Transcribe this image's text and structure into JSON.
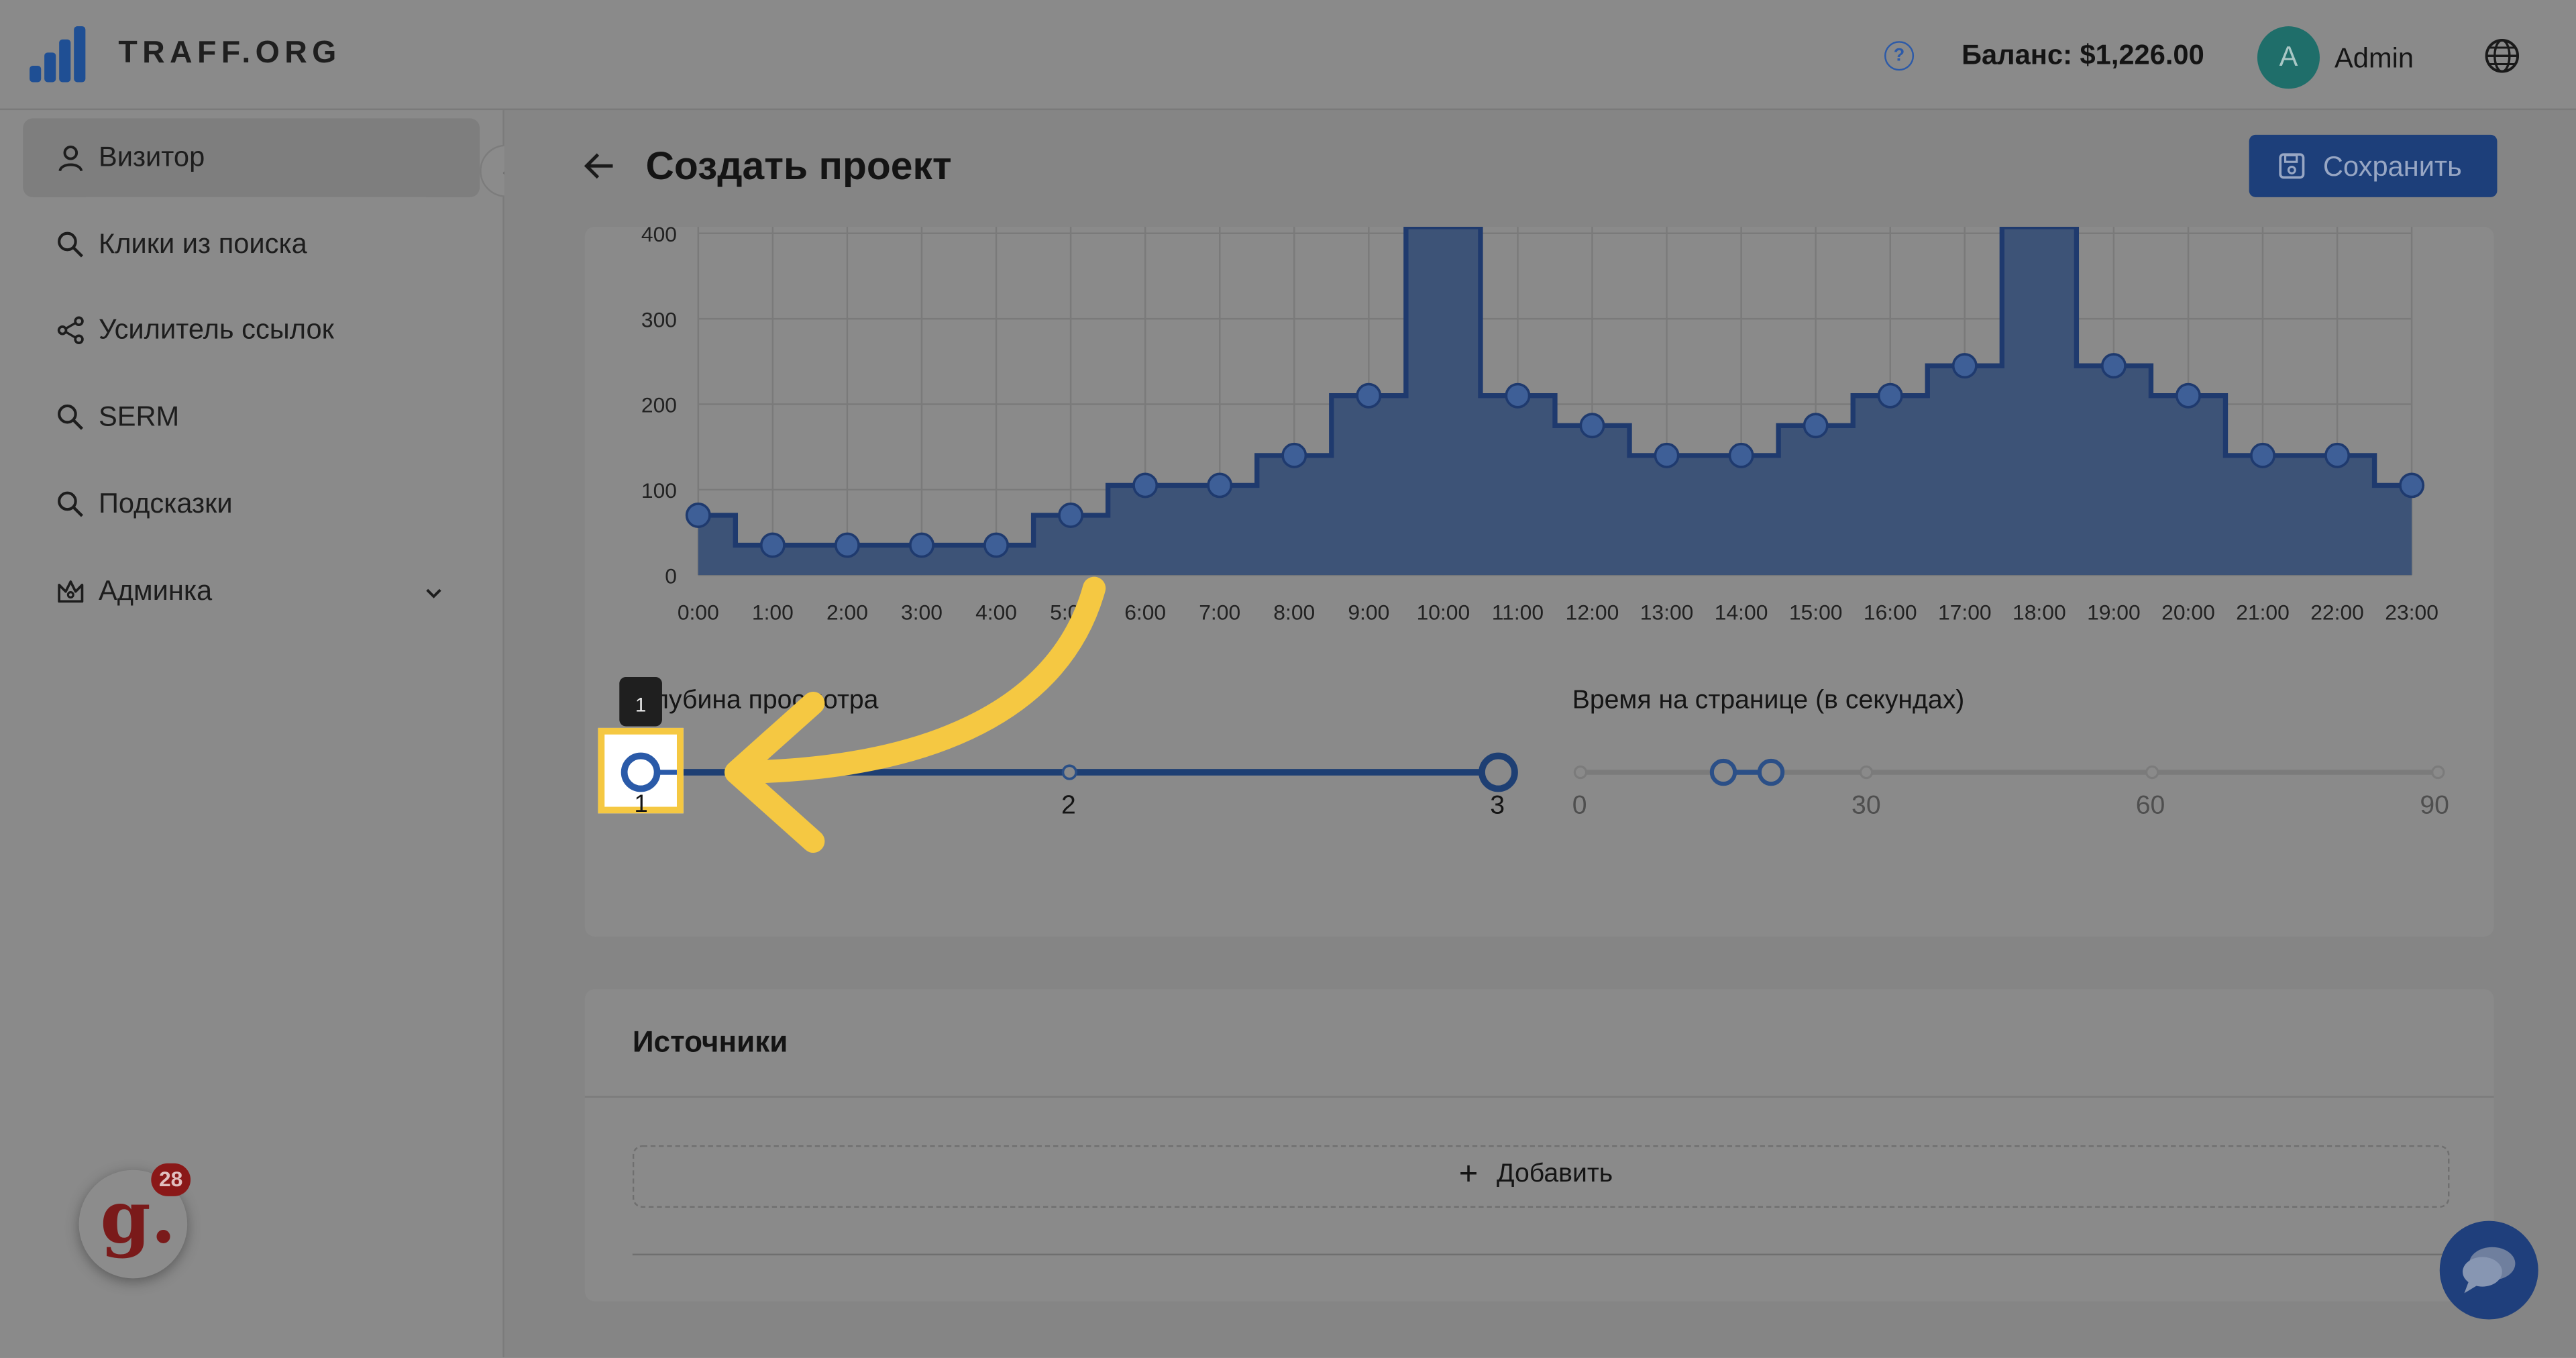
{
  "app": {
    "brand": "TRAFF.ORG"
  },
  "topbar": {
    "balance": "Баланс: $1,226.00",
    "avatar_letter": "A",
    "username": "Admin"
  },
  "sidebar": {
    "items": [
      {
        "label": "Визитор",
        "icon": "user-icon",
        "active": true
      },
      {
        "label": "Клики из поиска",
        "icon": "search-icon"
      },
      {
        "label": "Усилитель ссылок",
        "icon": "share-icon"
      },
      {
        "label": "SERM",
        "icon": "search-icon"
      },
      {
        "label": "Подсказки",
        "icon": "search-icon"
      },
      {
        "label": "Админка",
        "icon": "crown-icon",
        "has_chevron": true
      }
    ]
  },
  "page": {
    "title": "Создать проект",
    "save_label": "Сохранить"
  },
  "chart_data": {
    "type": "area",
    "step": true,
    "categories": [
      "0:00",
      "1:00",
      "2:00",
      "3:00",
      "4:00",
      "5:00",
      "6:00",
      "7:00",
      "8:00",
      "9:00",
      "10:00",
      "11:00",
      "12:00",
      "13:00",
      "14:00",
      "15:00",
      "16:00",
      "17:00",
      "18:00",
      "19:00",
      "20:00",
      "21:00",
      "22:00",
      "23:00"
    ],
    "values": [
      70,
      35,
      35,
      35,
      35,
      70,
      105,
      105,
      140,
      210,
      460,
      210,
      175,
      140,
      140,
      175,
      210,
      245,
      460,
      245,
      210,
      140,
      140,
      105
    ],
    "yticks": [
      "0",
      "100",
      "200",
      "300",
      "400"
    ],
    "ylim": [
      0,
      400
    ],
    "grid": true,
    "color": "#1f3a6e"
  },
  "depth_slider": {
    "label": "Глубина просмотра",
    "ticks": [
      "1",
      "2",
      "3"
    ],
    "tooltip": "1",
    "range": [
      1,
      3
    ]
  },
  "time_slider": {
    "label": "Время на странице (в секундах)",
    "ticks": [
      "0",
      "30",
      "60",
      "90"
    ],
    "range": [
      15,
      20
    ]
  },
  "sources": {
    "title": "Источники",
    "add_label": "Добавить"
  },
  "widgets": {
    "badge_count": "28",
    "badge_letter": "g."
  }
}
